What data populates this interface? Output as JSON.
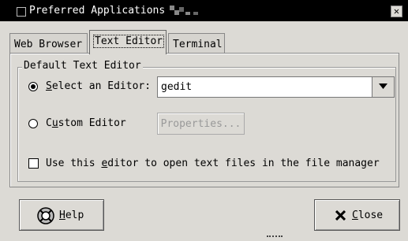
{
  "window": {
    "title": "Preferred Applications",
    "close_glyph": "✕"
  },
  "tabs": [
    {
      "label": "Web Browser",
      "active": false
    },
    {
      "label": "Text Editor",
      "active": true
    },
    {
      "label": "Terminal",
      "active": false
    }
  ],
  "section": {
    "legend": "Default Text Editor"
  },
  "select_editor": {
    "label_prefix": "",
    "mnemonic": "S",
    "label_rest": "elect an Editor:",
    "checked": true,
    "combo_value": "gedit"
  },
  "custom_editor": {
    "label_prefix": "C",
    "mnemonic": "u",
    "label_rest": "stom Editor",
    "checked": false,
    "properties_label": "Properties..."
  },
  "open_text_files": {
    "label_prefix": "Use this ",
    "mnemonic": "e",
    "label_rest": "ditor to open text files in the file manager",
    "checked": false
  },
  "buttons": {
    "help": {
      "mnemonic": "H",
      "rest": "elp",
      "icon": "help-lifebuoy-icon"
    },
    "close": {
      "mnemonic": "C",
      "rest": "lose",
      "icon": "close-x-icon"
    }
  }
}
